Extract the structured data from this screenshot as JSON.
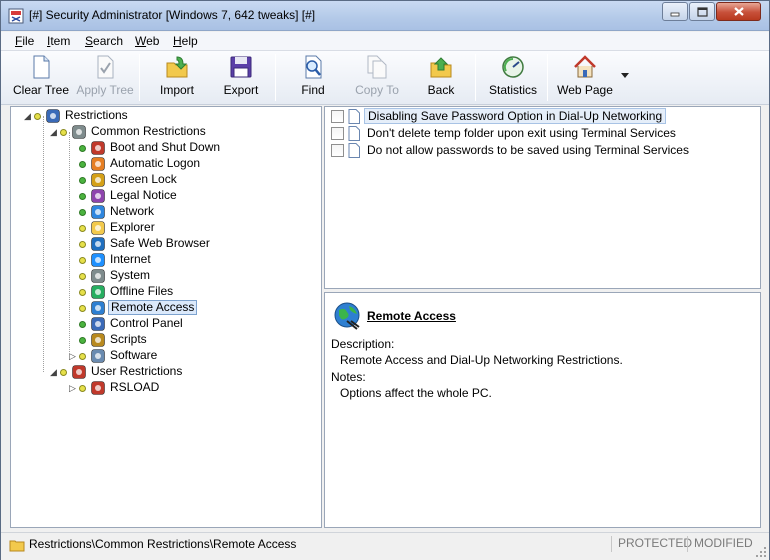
{
  "window": {
    "title": "[#] Security Administrator [Windows 7, 642 tweaks] [#]"
  },
  "menu": {
    "items": [
      {
        "label": "File",
        "u": "F",
        "rest": "ile"
      },
      {
        "label": "Item",
        "u": "I",
        "rest": "tem"
      },
      {
        "label": "Search",
        "u": "S",
        "rest": "earch"
      },
      {
        "label": "Web",
        "u": "W",
        "rest": "eb"
      },
      {
        "label": "Help",
        "u": "H",
        "rest": "elp"
      }
    ]
  },
  "toolbar": {
    "clear_tree": "Clear Tree",
    "apply_tree": "Apply Tree",
    "import": "Import",
    "export": "Export",
    "find": "Find",
    "copy_to": "Copy To",
    "back": "Back",
    "statistics": "Statistics",
    "web_page": "Web Page"
  },
  "tree": {
    "root": "Restrictions",
    "common": "Common Restrictions",
    "items": [
      {
        "label": "Boot and Shut Down",
        "dot": "green",
        "icon": "power-icon"
      },
      {
        "label": "Automatic Logon",
        "dot": "green",
        "icon": "logon-icon"
      },
      {
        "label": "Screen Lock",
        "dot": "green",
        "icon": "lock-icon"
      },
      {
        "label": "Legal Notice",
        "dot": "green",
        "icon": "legal-icon"
      },
      {
        "label": "Network",
        "dot": "green",
        "icon": "network-icon"
      },
      {
        "label": "Explorer",
        "dot": "yellow",
        "icon": "folder-icon"
      },
      {
        "label": "Safe Web Browser",
        "dot": "yellow",
        "icon": "globe-icon"
      },
      {
        "label": "Internet",
        "dot": "yellow",
        "icon": "ie-icon"
      },
      {
        "label": "System",
        "dot": "yellow",
        "icon": "system-icon"
      },
      {
        "label": "Offline Files",
        "dot": "yellow",
        "icon": "sync-icon"
      },
      {
        "label": "Remote Access",
        "dot": "yellow",
        "icon": "remote-icon"
      },
      {
        "label": "Control Panel",
        "dot": "green",
        "icon": "control-panel-icon"
      },
      {
        "label": "Scripts",
        "dot": "green",
        "icon": "script-icon"
      },
      {
        "label": "Software",
        "dot": "yellow",
        "icon": "software-icon"
      }
    ],
    "user": "User Restrictions",
    "user_items": [
      {
        "label": "RSLOAD",
        "dot": "yellow",
        "icon": "user-icon"
      }
    ]
  },
  "list": {
    "items": [
      {
        "label": "Disabling Save Password Option in Dial-Up Networking",
        "checked": false
      },
      {
        "label": "Don't delete temp folder upon exit using Terminal Services",
        "checked": false
      },
      {
        "label": "Do not allow passwords to be saved using Terminal Services",
        "checked": false
      }
    ]
  },
  "detail": {
    "title": "Remote Access",
    "description_label": "Description:",
    "description": "Remote Access and Dial-Up Networking Restrictions.",
    "notes_label": "Notes:",
    "notes": "Options affect the whole PC."
  },
  "status": {
    "path": "Restrictions\\Common Restrictions\\Remote Access",
    "protected": "PROTECTED",
    "modified": "MODIFIED"
  },
  "colors": {
    "selection_bg": "#dbe9fb",
    "selection_border": "#7da2ce",
    "dot_green": "#4bb33f",
    "dot_yellow": "#e6e04a"
  }
}
